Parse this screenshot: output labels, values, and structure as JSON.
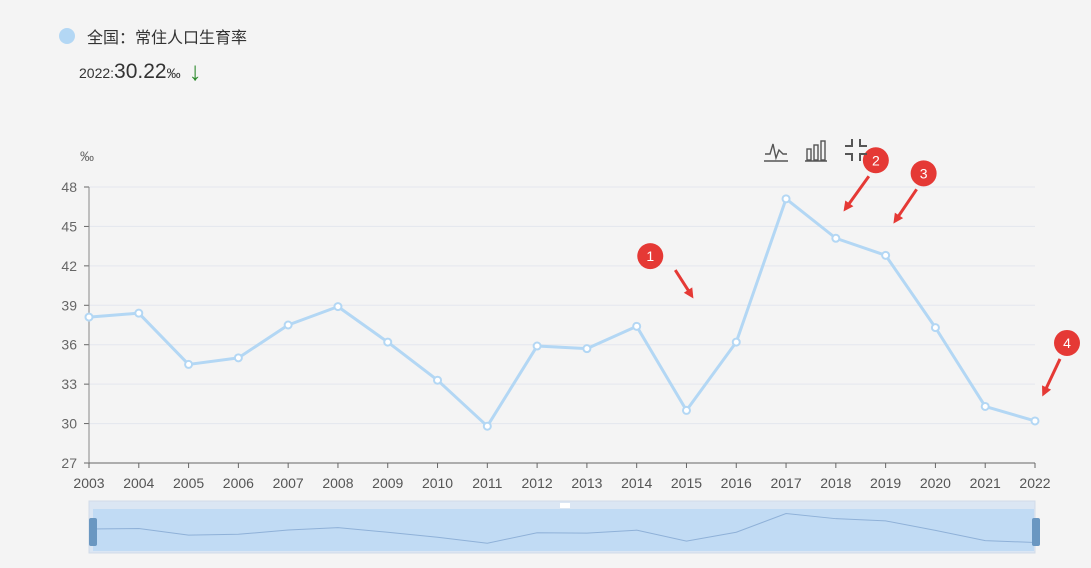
{
  "legend": {
    "series_name": "全国：常住人口生育率",
    "color": "#b3d7f4"
  },
  "summary": {
    "year": "2022",
    "value": "30.22",
    "unit": "‰",
    "trend": "down",
    "trend_color": "#2e8b2e"
  },
  "toolbox": {
    "icons": [
      "line-chart-icon",
      "bar-chart-icon",
      "restore-icon"
    ]
  },
  "chart_data": {
    "type": "line",
    "x": [
      "2003",
      "2004",
      "2005",
      "2006",
      "2007",
      "2008",
      "2009",
      "2010",
      "2011",
      "2012",
      "2013",
      "2014",
      "2015",
      "2016",
      "2017",
      "2018",
      "2019",
      "2020",
      "2021",
      "2022"
    ],
    "series": [
      {
        "name": "全国：常住人口生育率",
        "values": [
          38.1,
          38.4,
          34.5,
          35.0,
          37.5,
          38.9,
          36.2,
          33.3,
          29.8,
          35.9,
          35.7,
          37.4,
          31.0,
          36.2,
          47.1,
          44.1,
          42.8,
          37.3,
          31.3,
          30.2
        ]
      }
    ],
    "yunit": "‰",
    "ylim": [
      27,
      48
    ],
    "yticks": [
      27,
      30,
      33,
      36,
      39,
      42,
      45,
      48
    ],
    "grid": true,
    "line_color": "#b3d7f4",
    "annotations": [
      {
        "label": "1",
        "target_year": "2016"
      },
      {
        "label": "2",
        "target_year": "2018"
      },
      {
        "label": "3",
        "target_year": "2019"
      },
      {
        "label": "4",
        "target_year": "2022"
      }
    ],
    "annotation_color": "#e53935"
  }
}
